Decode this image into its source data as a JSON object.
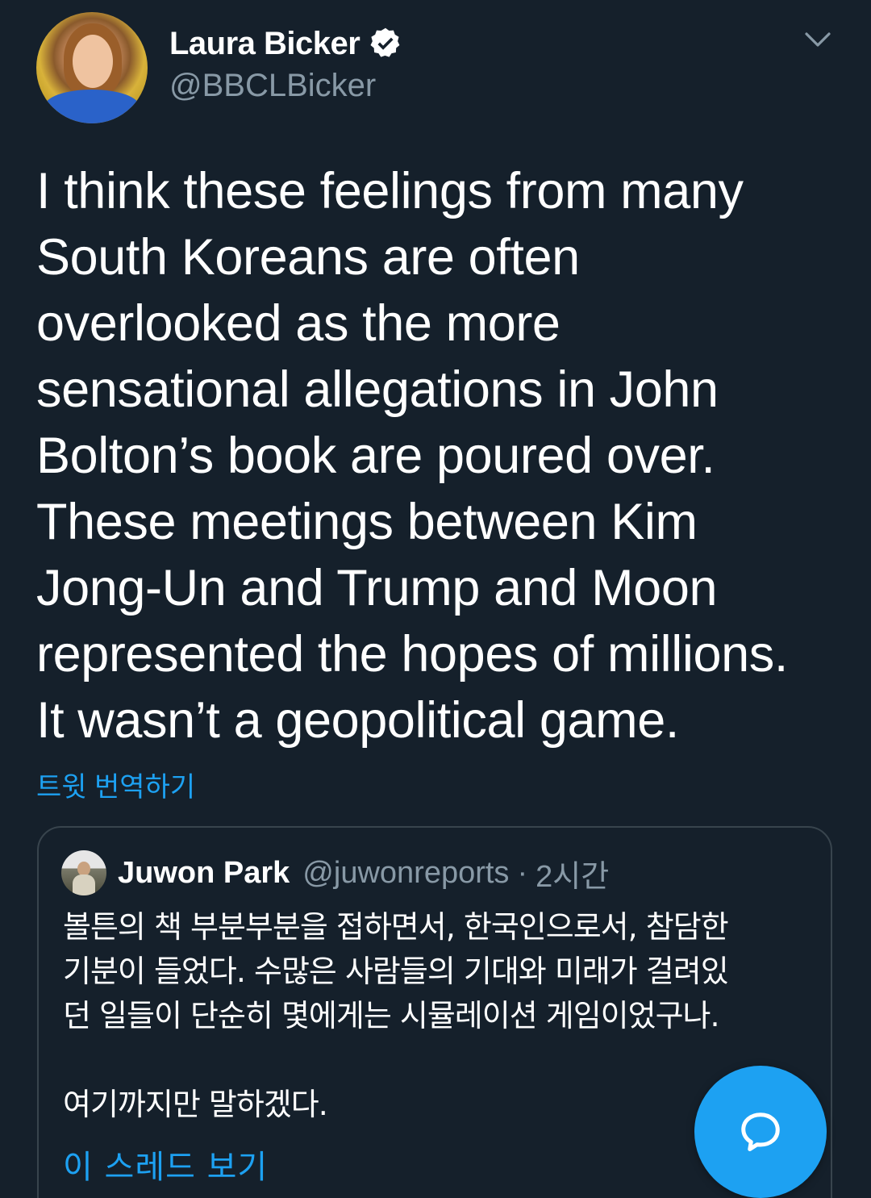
{
  "author": {
    "display_name": "Laura Bicker",
    "handle": "@BBCLBicker",
    "verified_icon": "verified-badge-icon"
  },
  "tweet": {
    "text": "I think these feelings from many\nSouth Koreans are often\noverlooked as the more\nsensational allegations in John\nBolton’s book are poured over.\nThese meetings between Kim\nJong-Un and Trump and Moon\nrepresented the hopes of millions.\nIt wasn’t a geopolitical game.",
    "translate_label": "트윗 번역하기"
  },
  "quote": {
    "display_name": "Juwon Park",
    "handle": "@juwonreports",
    "separator": "·",
    "time": "2시간",
    "text": "볼튼의 책 부분부분을 접하면서, 한국인으로서, 참담한\n기분이 들었다. 수많은 사람들의 기대와 미래가 걸려있\n던 일들이 단순히 몇에게는 시뮬레이션 게임이었구나.\n\n여기까지만 말하겠다.",
    "thread_label": "이 스레드 보기"
  },
  "icons": {
    "menu": "chevron-down-icon",
    "compose": "chat-bubble-icon"
  },
  "colors": {
    "background": "#15202b",
    "accent": "#1da1f2",
    "secondary_text": "#8899a6",
    "border": "#38444d"
  }
}
